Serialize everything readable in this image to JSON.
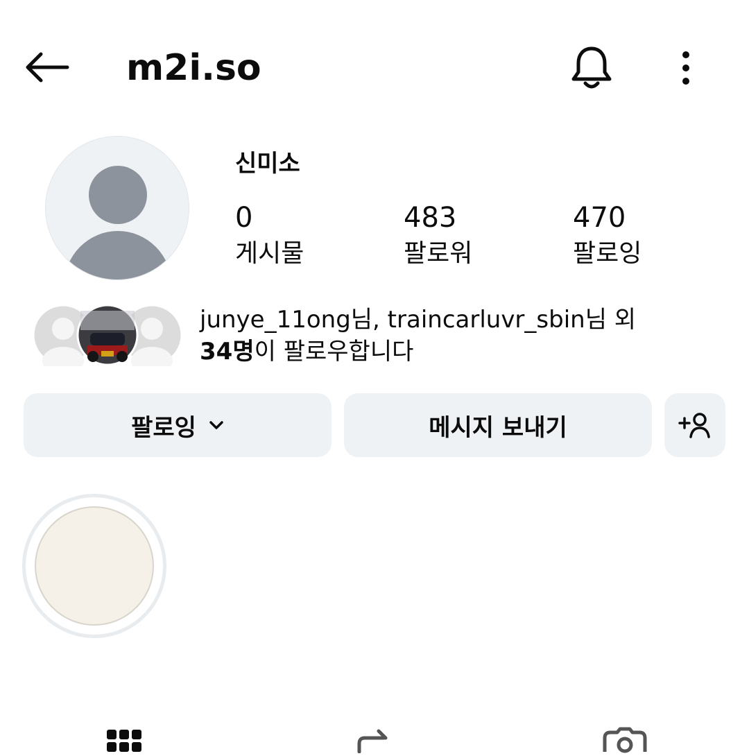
{
  "header": {
    "title": "m2i.so",
    "back_icon": "back-arrow-icon",
    "bell_icon": "bell-icon",
    "more_icon": "more-vertical-icon"
  },
  "profile": {
    "display_name": "신미소",
    "stats": [
      {
        "value": "0",
        "label": "게시물"
      },
      {
        "value": "483",
        "label": "팔로워"
      },
      {
        "value": "470",
        "label": "팔로잉"
      }
    ]
  },
  "mutual": {
    "line1": "junye_11ong님, traincarluvr_sbin님 외",
    "count": "34명",
    "line2_rest": "이 팔로우합니다"
  },
  "actions": {
    "following_label": "팔로잉",
    "message_label": "메시지 보내기",
    "add_user_icon": "add-user-icon"
  },
  "tabs": [
    {
      "icon": "grid-icon"
    },
    {
      "icon": "reels-icon"
    },
    {
      "icon": "tagged-icon"
    }
  ],
  "colors": {
    "button_bg": "#eff2f5",
    "text": "#0c0c0c",
    "avatar_placeholder": "#8c939c"
  }
}
